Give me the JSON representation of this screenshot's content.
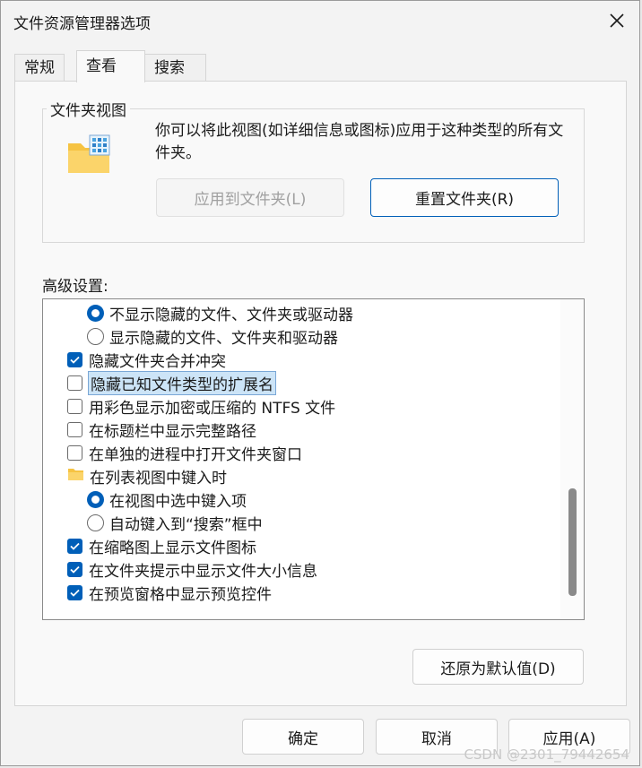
{
  "window": {
    "title": "文件资源管理器选项",
    "close_icon": "close-icon"
  },
  "tabs": [
    {
      "label": "常规",
      "active": false
    },
    {
      "label": "查看",
      "active": true
    },
    {
      "label": "搜索",
      "active": false
    }
  ],
  "folder_views": {
    "group_label": "文件夹视图",
    "description": "你可以将此视图(如详细信息或图标)应用于这种类型的所有文件夹。",
    "apply_button": "应用到文件夹(L)",
    "reset_button": "重置文件夹(R)"
  },
  "advanced": {
    "label": "高级设置:",
    "items": [
      {
        "type": "radio",
        "checked": true,
        "indent": 1,
        "label": "不显示隐藏的文件、文件夹或驱动器"
      },
      {
        "type": "radio",
        "checked": false,
        "indent": 1,
        "label": "显示隐藏的文件、文件夹和驱动器"
      },
      {
        "type": "checkbox",
        "checked": true,
        "indent": 0,
        "label": "隐藏文件夹合并冲突"
      },
      {
        "type": "checkbox",
        "checked": false,
        "indent": 0,
        "label": "隐藏已知文件类型的扩展名",
        "selected": true
      },
      {
        "type": "checkbox",
        "checked": false,
        "indent": 0,
        "label": "用彩色显示加密或压缩的 NTFS 文件"
      },
      {
        "type": "checkbox",
        "checked": false,
        "indent": 0,
        "label": "在标题栏中显示完整路径"
      },
      {
        "type": "checkbox",
        "checked": false,
        "indent": 0,
        "label": "在单独的进程中打开文件夹窗口"
      },
      {
        "type": "folder",
        "indent": 0,
        "label": "在列表视图中键入时"
      },
      {
        "type": "radio",
        "checked": true,
        "indent": 1,
        "label": "在视图中选中键入项"
      },
      {
        "type": "radio",
        "checked": false,
        "indent": 1,
        "label": "自动键入到“搜索”框中"
      },
      {
        "type": "checkbox",
        "checked": true,
        "indent": 0,
        "label": "在缩略图上显示文件图标"
      },
      {
        "type": "checkbox",
        "checked": true,
        "indent": 0,
        "label": "在文件夹提示中显示文件大小信息"
      },
      {
        "type": "checkbox",
        "checked": true,
        "indent": 0,
        "label": "在预览窗格中显示预览控件"
      }
    ],
    "restore_button": "还原为默认值(D)"
  },
  "footer": {
    "ok": "确定",
    "cancel": "取消",
    "apply": "应用(A)"
  },
  "watermark": "CSDN @2301_79442654",
  "colors": {
    "accent": "#005fb8",
    "selection": "#cce4f7"
  }
}
